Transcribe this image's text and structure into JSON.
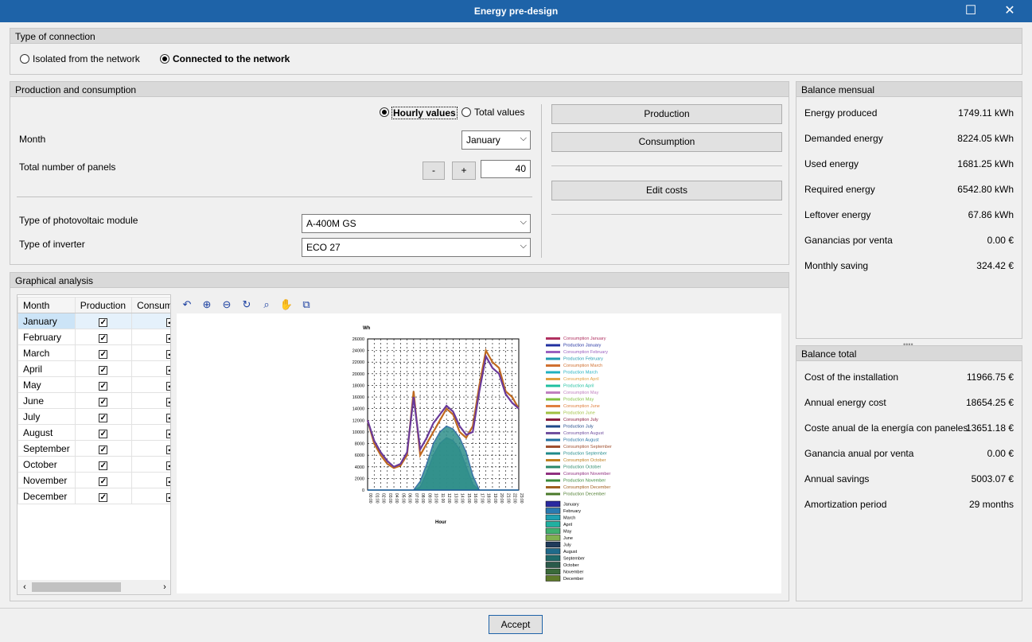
{
  "window": {
    "title": "Energy pre-design"
  },
  "connection": {
    "header": "Type of connection",
    "options": [
      "Isolated from the network",
      "Connected to the network"
    ]
  },
  "production": {
    "header": "Production and consumption",
    "hourly_label": "Hourly values",
    "total_label": "Total values",
    "month_label": "Month",
    "month_value": "January",
    "panels_label": "Total number of panels",
    "minus": "-",
    "plus": "+",
    "panels_value": "40",
    "module_label": "Type of photovoltaic module",
    "module_value": "A-400M GS",
    "inverter_label": "Type of inverter",
    "inverter_value": "ECO 27",
    "production_btn": "Production",
    "consumption_btn": "Consumption",
    "edit_costs_btn": "Edit costs"
  },
  "graph": {
    "header": "Graphical analysis",
    "columns": [
      "Month",
      "Production",
      "Consum"
    ],
    "months": [
      "January",
      "February",
      "March",
      "April",
      "May",
      "June",
      "July",
      "August",
      "September",
      "October",
      "November",
      "December"
    ]
  },
  "balance_monthly": {
    "header": "Balance mensual",
    "rows": [
      {
        "label": "Energy produced",
        "value": "1749.11  kWh"
      },
      {
        "label": "Demanded energy",
        "value": "8224.05  kWh"
      },
      {
        "label": "Used energy",
        "value": "1681.25  kWh"
      },
      {
        "label": "Required energy",
        "value": "6542.80  kWh"
      },
      {
        "label": "Leftover energy",
        "value": "67.86  kWh"
      },
      {
        "label": "Ganancias por venta",
        "value": "0.00  €"
      },
      {
        "label": "Monthly saving",
        "value": "324.42  €"
      }
    ]
  },
  "balance_total": {
    "header": "Balance total",
    "rows": [
      {
        "label": "Cost of the installation",
        "value": "11966.75  €"
      },
      {
        "label": "Annual energy cost",
        "value": "18654.25  €"
      },
      {
        "label": "Coste anual de la energía con paneles",
        "value": "13651.18  €"
      },
      {
        "label": "Ganancia anual por venta",
        "value": "0.00  €"
      },
      {
        "label": "Annual savings",
        "value": "5003.07  €"
      },
      {
        "label": "Amortization period",
        "value": "29  months"
      }
    ]
  },
  "accept_label": "Accept",
  "chart_data": {
    "type": "area",
    "ylabel": "Wh",
    "xlabel": "Hour",
    "ylim": [
      0,
      26000
    ],
    "yticks": [
      "26000",
      "24000",
      "22000",
      "20000",
      "18000",
      "16000",
      "14000",
      "12000",
      "10000",
      "8000",
      "6000",
      "4000",
      "2000",
      "0"
    ],
    "categories": [
      "00:00",
      "01:00",
      "02:00",
      "03:00",
      "04:00",
      "05:00",
      "06:00",
      "07:00",
      "08:00",
      "09:00",
      "10:00",
      "11:00",
      "12:00",
      "13:00",
      "14:00",
      "15:00",
      "16:00",
      "17:00",
      "18:00",
      "19:00",
      "20:00",
      "21:00",
      "22:00",
      "23:00"
    ],
    "series": [
      {
        "name": "Consumption January",
        "values": [
          12000,
          8000,
          6000,
          4500,
          3800,
          4200,
          6000,
          17000,
          6000,
          8000,
          10000,
          12000,
          14000,
          13000,
          10000,
          9000,
          11000,
          18000,
          24000,
          22000,
          21000,
          17000,
          16000,
          14000
        ]
      },
      {
        "name": "Production January",
        "values": [
          0,
          0,
          0,
          0,
          0,
          0,
          0,
          0,
          500,
          3000,
          6000,
          8000,
          9000,
          8500,
          7000,
          4000,
          1000,
          0,
          0,
          0,
          0,
          0,
          0,
          0
        ]
      },
      {
        "name": "Consumption July",
        "values": [
          12000,
          8500,
          6500,
          5000,
          4000,
          4500,
          6500,
          16000,
          7000,
          9000,
          11500,
          13000,
          14500,
          13500,
          11000,
          9500,
          10000,
          17000,
          23000,
          21000,
          20000,
          16500,
          15000,
          14000
        ]
      },
      {
        "name": "Production July",
        "values": [
          0,
          0,
          0,
          0,
          0,
          0,
          0,
          0,
          1500,
          4500,
          8000,
          10000,
          11000,
          10500,
          9000,
          6500,
          2500,
          0,
          0,
          0,
          0,
          0,
          0,
          0
        ]
      }
    ],
    "legend_entries": [
      "Consumption January",
      "Production January",
      "Consumption February",
      "Production February",
      "Consumption March",
      "Production March",
      "Consumption April",
      "Production April",
      "Consumption May",
      "Production May",
      "Consumption June",
      "Production June",
      "Consumption July",
      "Production July",
      "Consumption August",
      "Production August",
      "Consumption September",
      "Production September",
      "Consumption October",
      "Production October",
      "Consumption November",
      "Production November",
      "Consumption December",
      "Production December"
    ],
    "area_legend": [
      "January",
      "February",
      "March",
      "April",
      "May",
      "June",
      "July",
      "August",
      "September",
      "October",
      "November",
      "December"
    ]
  }
}
